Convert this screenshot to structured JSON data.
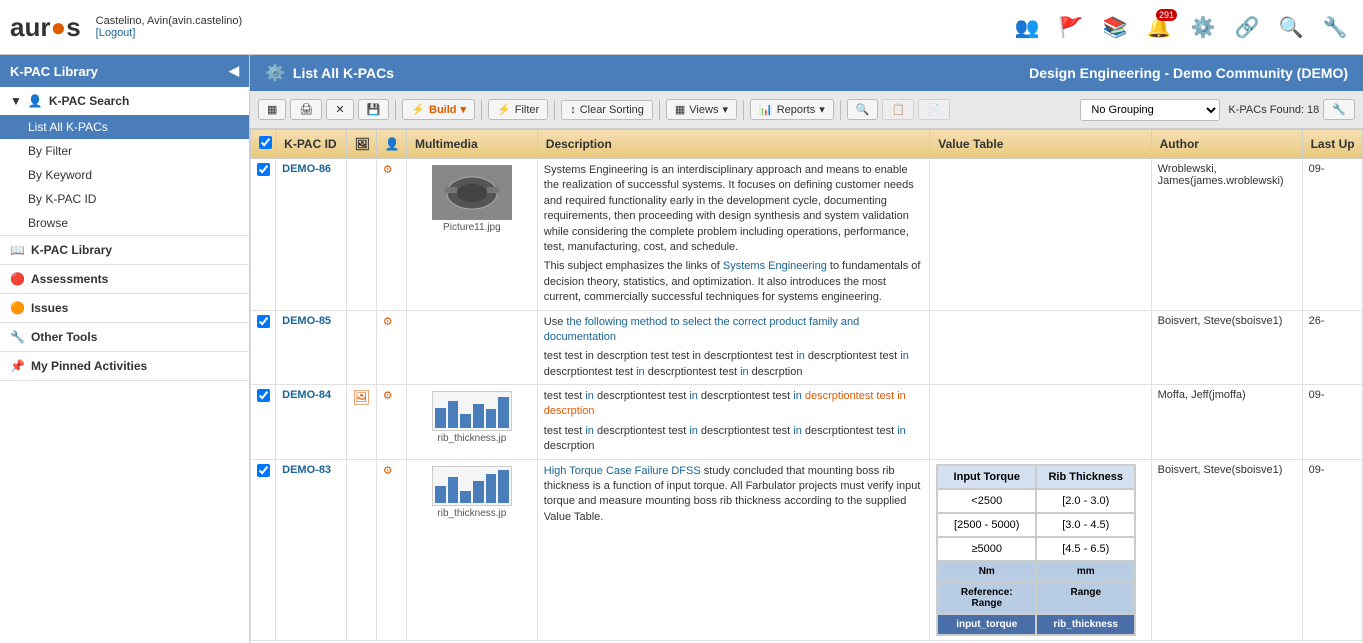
{
  "header": {
    "logo": "aur●s",
    "user": "Castelino, Avin(avin.castelino)",
    "logout": "[Logout]",
    "community": "Design Engineering - Demo Community (DEMO)"
  },
  "header_icons": [
    {
      "name": "people-icon",
      "symbol": "👥",
      "badge": null
    },
    {
      "name": "flag-icon",
      "symbol": "🚩",
      "badge": null
    },
    {
      "name": "books-icon",
      "symbol": "📚",
      "badge": null
    },
    {
      "name": "notifications-icon",
      "symbol": "🔔",
      "badge": "291"
    },
    {
      "name": "settings-icon",
      "symbol": "⚙️",
      "badge": null
    },
    {
      "name": "connect-icon",
      "symbol": "🔗",
      "badge": null
    },
    {
      "name": "search-icon",
      "symbol": "🔍",
      "badge": null
    },
    {
      "name": "tools-icon",
      "symbol": "🔧",
      "badge": null
    }
  ],
  "sidebar": {
    "title": "K-PAC Library",
    "sections": [
      {
        "name": "K-PAC Search",
        "items": [
          {
            "label": "List All K-PACs",
            "active": true
          },
          {
            "label": "By Filter",
            "active": false
          },
          {
            "label": "By Keyword",
            "active": false
          },
          {
            "label": "By K-PAC ID",
            "active": false
          },
          {
            "label": "Browse",
            "active": false
          }
        ]
      },
      {
        "name": "K-PAC Library",
        "items": []
      },
      {
        "name": "Assessments",
        "items": []
      },
      {
        "name": "Issues",
        "items": []
      },
      {
        "name": "Other Tools",
        "items": []
      },
      {
        "name": "My Pinned Activities",
        "items": []
      }
    ]
  },
  "toolbar": {
    "build_label": "Build",
    "filter_label": "Filter",
    "clear_sorting_label": "Clear Sorting",
    "views_label": "Views",
    "reports_label": "Reports",
    "grouping_label": "No Grouping",
    "kpac_count": "K-PACs Found: 18"
  },
  "table": {
    "columns": [
      "",
      "K-PAC ID",
      "",
      "",
      "Multimedia",
      "Description",
      "Value Table",
      "Author",
      "Last Up"
    ],
    "rows": [
      {
        "id": "DEMO-86",
        "checked": true,
        "has_img": true,
        "img_label": "Picture11.jpg",
        "desc_parts": [
          {
            "text": "Systems Engineering is an interdisciplinary approach and means to enable the realization of successful systems. It focuses on defining customer needs and required functionality early in the development cycle, documenting requirements, then proceeding with design synthesis and system validation while considering the complete problem including operations, performance, test, manufacturing, cost, and schedule.",
            "highlight": false
          },
          {
            "text": "This subject emphasizes the links of ",
            "highlight": false
          },
          {
            "text": "Systems Engineering",
            "highlight": true
          },
          {
            "text": " to fundamentals of decision theory, statistics, and optimization. It also introduces the most current, commercially successful techniques for systems engineering.",
            "highlight": false
          }
        ],
        "value_table": "",
        "author": "Wroblewski, James(james.wroblewski)",
        "last_up": "09-"
      },
      {
        "id": "DEMO-85",
        "checked": true,
        "has_img": false,
        "img_label": "",
        "desc_parts": [
          {
            "text": "Use ",
            "highlight": false
          },
          {
            "text": "the following method to select the correct product family and documentation",
            "highlight": true
          },
          {
            "text": "",
            "highlight": false
          }
        ],
        "desc2_parts": [
          {
            "text": "test test in descrption test test in descrptiontest test in descrptiontest test in descrptiontest test in descrptiontest test in descrption",
            "highlight": false
          }
        ],
        "value_table": "",
        "author": "Boisvert, Steve(sboisve1)",
        "last_up": "26-"
      },
      {
        "id": "DEMO-84",
        "checked": true,
        "has_chart": true,
        "img_label": "rib_thickness.jp",
        "desc_parts": [
          {
            "text": "test test in descrptiontest test in descrptiontest test in ",
            "highlight": false
          },
          {
            "text": "descrptiontest test in descrption",
            "highlight": true
          }
        ],
        "desc2_parts": [
          {
            "text": "test test in descrptiontest test in descrptiontest test in descrptiontest test in descrption",
            "highlight": false
          }
        ],
        "value_table": "",
        "author": "Moffa, Jeff(jmoffa)",
        "last_up": "09-"
      },
      {
        "id": "DEMO-83",
        "checked": true,
        "has_chart": true,
        "img_label": "rib_thickness.jp",
        "desc_parts": [
          {
            "text": "High Torque Case Failure DFSS study concluded that mounting boss rib thickness is a function of input torque. All Farbulator projects must verify input torque and measure mounting boss rib thickness according to the supplied Value Table.",
            "highlight": false
          }
        ],
        "value_table": "show",
        "author": "Boisvert, Steve(sboisve1)",
        "last_up": "09-"
      }
    ],
    "value_table_data": {
      "headers": [
        "Input Torque",
        "Rib Thickness"
      ],
      "rows": [
        [
          "<2500",
          "[2.0 - 3.0)"
        ],
        [
          "[2500 - 5000)",
          "[3.0 - 4.5)"
        ],
        [
          "≥5000",
          "[4.5 - 6.5)"
        ]
      ],
      "units": [
        "Nm",
        "mm"
      ],
      "footer": [
        "Reference: Range",
        "Range"
      ],
      "keys": [
        "input_torque",
        "rib_thickness"
      ]
    }
  }
}
